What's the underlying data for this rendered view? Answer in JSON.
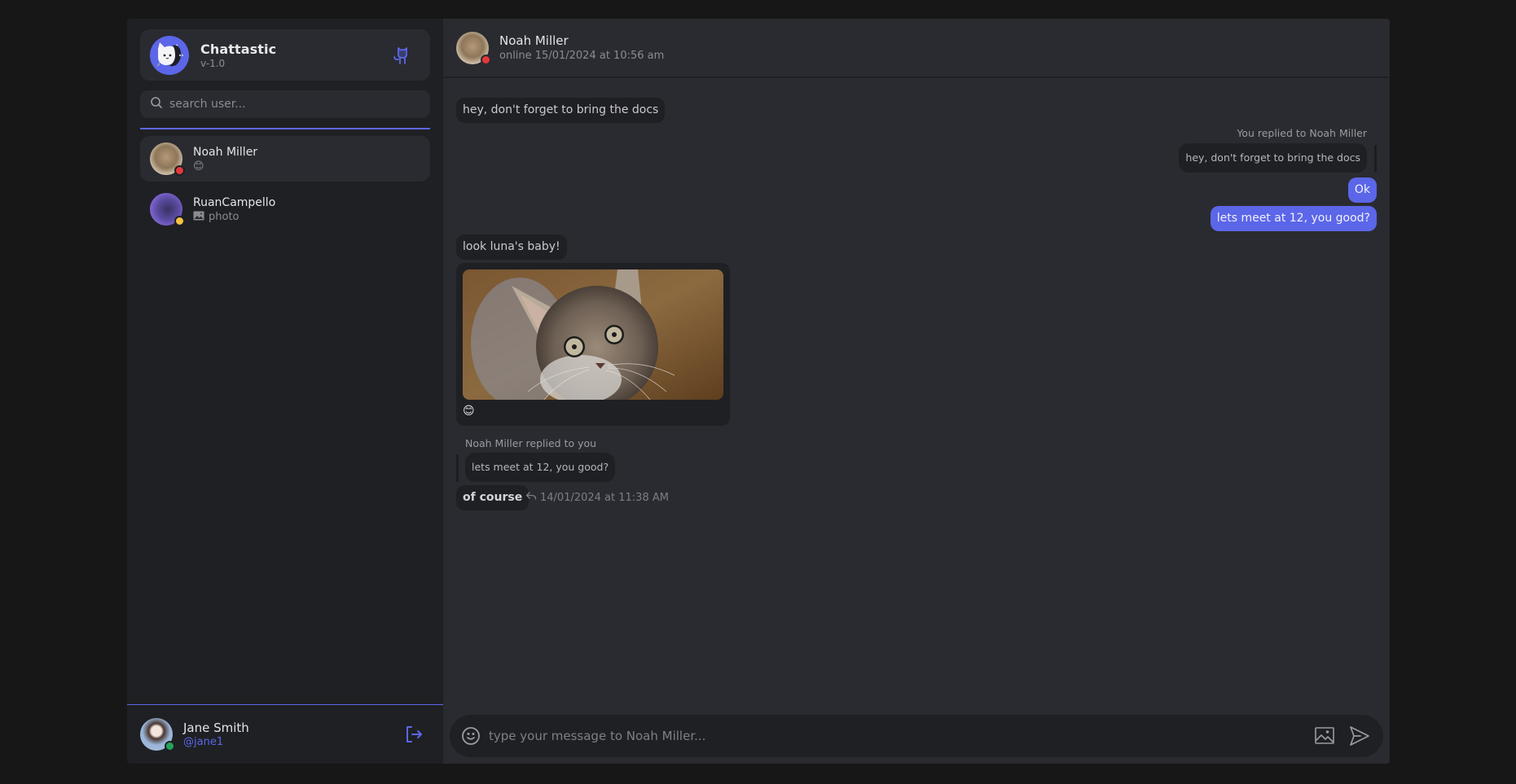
{
  "app": {
    "name": "Chattastic",
    "version": "v-1.0",
    "accent_color": "#5b66e8"
  },
  "sidebar": {
    "search": {
      "placeholder": "search user..."
    },
    "contacts": [
      {
        "name": "Noah Miller",
        "preview": "😊",
        "preview_type": "emoji",
        "status_color": "#e5383b",
        "active": true
      },
      {
        "name": "RuanCampello",
        "preview": "photo",
        "preview_type": "photo",
        "status_color": "#f5c542",
        "active": false
      }
    ],
    "current_user": {
      "name": "Jane Smith",
      "username": "@jane1",
      "status_color": "#22a55a"
    }
  },
  "chat": {
    "header": {
      "name": "Noah Miller",
      "status": "online 15/01/2024 at 10:56 am",
      "status_color": "#e5383b"
    },
    "messages": [
      {
        "id": "m1",
        "from": "them",
        "text": "hey, don't forget to bring the docs"
      },
      {
        "id": "m2",
        "from": "me",
        "reply_label": "You replied to Noah Miller",
        "reply_quote": "hey, don't forget to bring the docs",
        "text": "Ok"
      },
      {
        "id": "m3",
        "from": "me",
        "text": "lets meet at 12, you good?"
      },
      {
        "id": "m4",
        "from": "them",
        "text": "look luna's baby!"
      },
      {
        "id": "m5",
        "from": "them",
        "type": "image",
        "alt": "kitten photo",
        "reaction": "😊"
      },
      {
        "id": "m6",
        "from": "them",
        "reply_label": "Noah Miller replied to you",
        "reply_quote": "lets meet at 12, you good?",
        "text": "of course",
        "timestamp": "14/01/2024 at 11:38 AM"
      }
    ],
    "composer": {
      "placeholder": "type your message to Noah Miller..."
    }
  },
  "icons": {
    "search": "search-icon",
    "github_cat": "github-cat-icon",
    "logout": "logout-icon",
    "emoji": "emoji-icon",
    "image": "image-icon",
    "send": "send-icon",
    "reply": "reply-arrow-icon"
  }
}
